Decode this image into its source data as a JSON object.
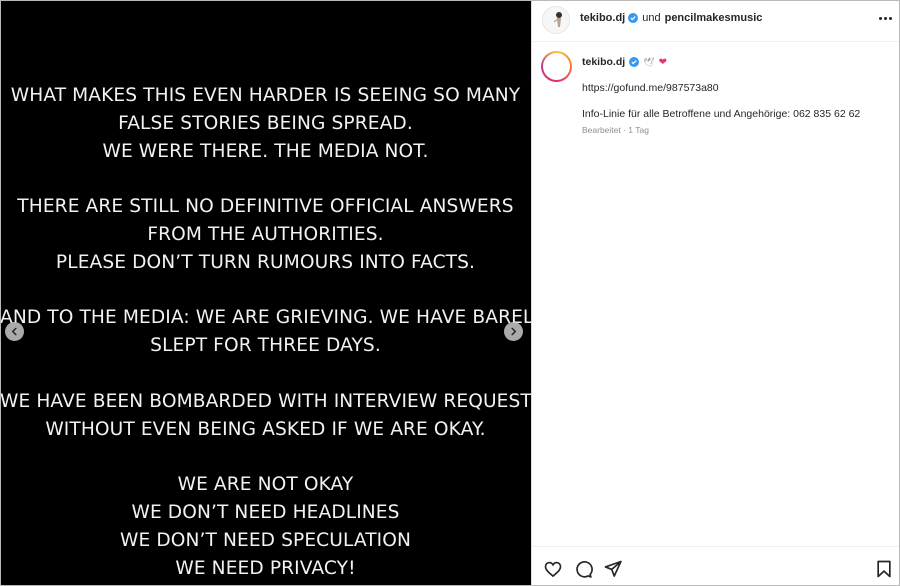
{
  "post": {
    "slide_lines": [
      "WHAT MAKES THIS EVEN HARDER IS SEEING SO MANY",
      "FALSE STORIES BEING SPREAD.",
      "WE WERE THERE. THE MEDIA NOT.",
      "",
      "THERE ARE STILL NO DEFINITIVE OFFICIAL ANSWERS",
      "FROM THE AUTHORITIES.",
      "PLEASE DON’T TURN RUMOURS INTO FACTS.",
      "",
      "AND TO THE MEDIA: WE ARE GRIEVING. WE HAVE BARELY",
      "SLEPT FOR THREE DAYS.",
      "",
      "WE HAVE BEEN BOMBARDED WITH INTERVIEW REQUESTS",
      "WITHOUT EVEN BEING ASKED IF WE ARE OKAY.",
      "",
      "WE ARE NOT OKAY",
      "WE DON’T NEED HEADLINES",
      "WE DON’T NEED SPECULATION",
      "WE NEED PRIVACY!"
    ]
  },
  "header": {
    "author": "tekibo.dj",
    "conjunction": "und",
    "collaborator": "pencilmakesmusic",
    "more_icon": "more-horizontal-icon"
  },
  "caption": {
    "username": "tekibo.dj",
    "emoji_dove": "🕊",
    "emoji_heart": "❤",
    "link": "https://gofund.me/987573a80",
    "info": "Info-Linie für alle Betroffene und Angehörige: 062 835 62 62",
    "meta": "Bearbeitet · 1 Tag"
  },
  "actions": {
    "like_icon": "heart-icon",
    "comment_icon": "comment-icon",
    "share_icon": "share-icon",
    "save_icon": "bookmark-icon"
  },
  "colors": {
    "verified": "#3897f0",
    "heart": "#e8356d",
    "media_bg": "#000000",
    "text_primary": "#262626",
    "text_secondary": "#8e8e8e"
  }
}
